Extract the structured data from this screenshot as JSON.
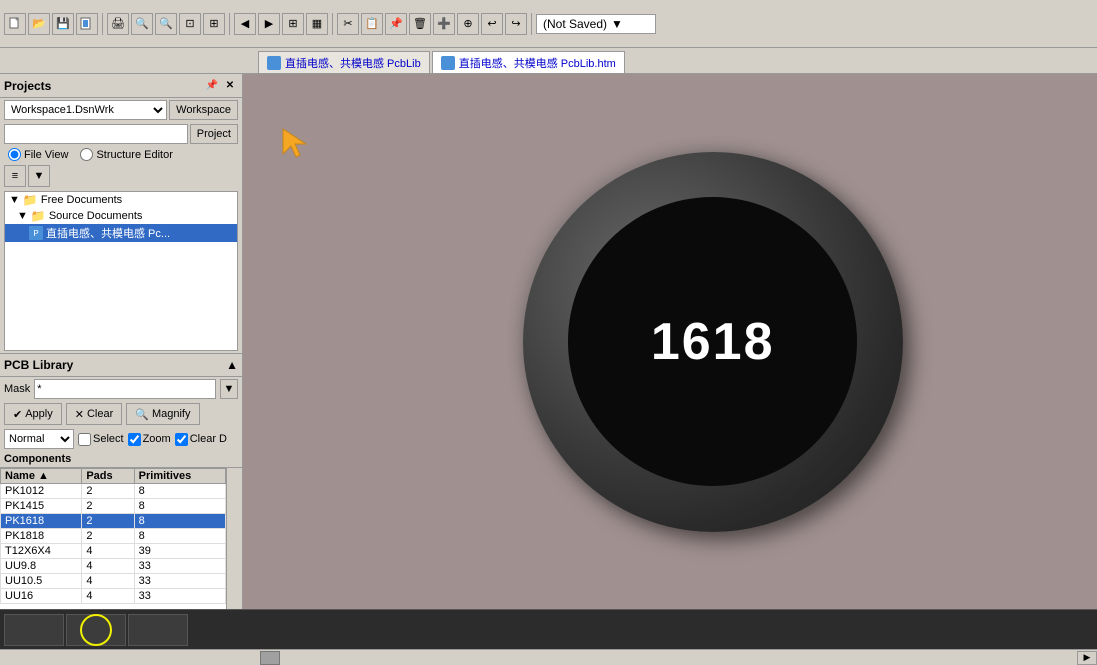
{
  "toolbar": {
    "not_saved": "(Not Saved)",
    "dropdown_arrow": "▼"
  },
  "tabs": [
    {
      "id": "tab1",
      "label": "直插电感、共模电感 PcbLib",
      "active": false
    },
    {
      "id": "tab2",
      "label": "直插电感、共模电感 PcbLib.htm",
      "active": true
    }
  ],
  "projects_panel": {
    "title": "Projects",
    "workspace_value": "Workspace1.DsnWrk",
    "workspace_label": "Workspace",
    "project_btn": "Project",
    "file_view_label": "File View",
    "structure_editor_label": "Structure Editor",
    "tree": [
      {
        "level": 0,
        "type": "folder",
        "label": "Free Documents",
        "expanded": true
      },
      {
        "level": 1,
        "type": "folder",
        "label": "Source Documents",
        "expanded": true
      },
      {
        "level": 2,
        "type": "file",
        "label": "直插电感、共模电感 Pc...",
        "selected": true
      }
    ]
  },
  "pcb_library": {
    "title": "PCB Library",
    "mask_label": "Mask",
    "mask_value": "*",
    "apply_btn": "Apply",
    "clear_btn": "Clear",
    "magnify_btn": "Magnify",
    "normal_label": "Normal",
    "select_label": "Select",
    "zoom_label": "Zoom",
    "clear_d_label": "Clear D",
    "components_label": "Components",
    "columns": [
      {
        "id": "name",
        "label": "Name",
        "sort": "▲"
      },
      {
        "id": "pads",
        "label": "Pads"
      },
      {
        "id": "primitives",
        "label": "Primitives"
      }
    ],
    "rows": [
      {
        "name": "PK1012",
        "pads": "2",
        "primitives": "8",
        "selected": false
      },
      {
        "name": "PK1415",
        "pads": "2",
        "primitives": "8",
        "selected": false
      },
      {
        "name": "PK1618",
        "pads": "2",
        "primitives": "8",
        "selected": true
      },
      {
        "name": "PK1818",
        "pads": "2",
        "primitives": "8",
        "selected": false
      },
      {
        "name": "T12X6X4",
        "pads": "4",
        "primitives": "39",
        "selected": false
      },
      {
        "name": "UU9.8",
        "pads": "4",
        "primitives": "33",
        "selected": false
      },
      {
        "name": "UU10.5",
        "pads": "4",
        "primitives": "33",
        "selected": false
      },
      {
        "name": "UU16",
        "pads": "4",
        "primitives": "33",
        "selected": false
      }
    ]
  },
  "component_display": {
    "number": "1618"
  },
  "bottom_bar": {
    "buttons": [
      "",
      "",
      ""
    ],
    "circle_present": true
  }
}
